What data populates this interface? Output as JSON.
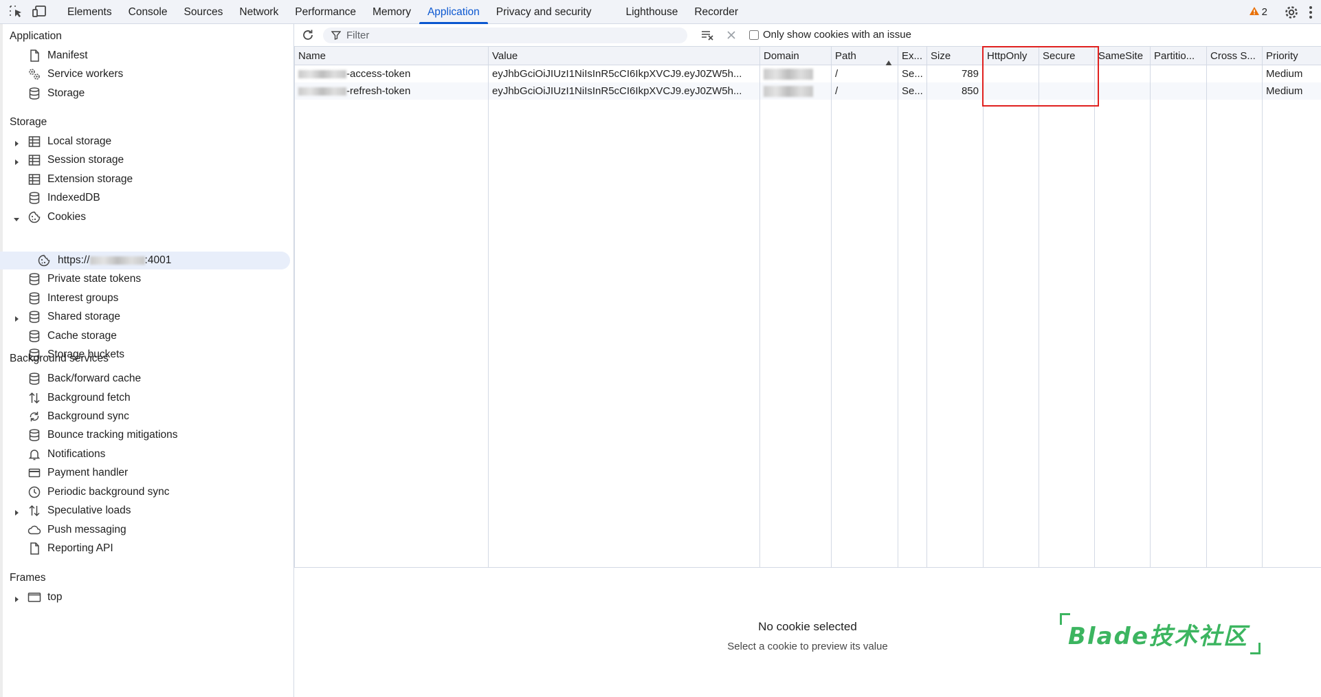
{
  "tabs": [
    {
      "label": "Elements"
    },
    {
      "label": "Console"
    },
    {
      "label": "Sources"
    },
    {
      "label": "Network"
    },
    {
      "label": "Performance"
    },
    {
      "label": "Memory"
    },
    {
      "label": "Application",
      "active": true
    },
    {
      "label": "Privacy and security"
    },
    {
      "label": "Lighthouse"
    },
    {
      "label": "Recorder"
    }
  ],
  "warnings": {
    "count": "2"
  },
  "colors": {
    "accent": "#0b57d0",
    "highlight": "#e0201e",
    "warning": "#e8710a",
    "watermark": "#3cb560"
  },
  "sidebar": {
    "application": {
      "title": "Application",
      "items": [
        {
          "label": "Manifest",
          "icon": "file-icon"
        },
        {
          "label": "Service workers",
          "icon": "gears-icon"
        },
        {
          "label": "Storage",
          "icon": "database-icon"
        }
      ]
    },
    "storage": {
      "title": "Storage",
      "items": [
        {
          "label": "Local storage",
          "icon": "table-icon"
        },
        {
          "label": "Session storage",
          "icon": "table-icon"
        },
        {
          "label": "Extension storage",
          "icon": "table-icon"
        },
        {
          "label": "IndexedDB",
          "icon": "database-icon"
        },
        {
          "label": "Cookies",
          "icon": "cookie-icon"
        },
        {
          "label": "https://",
          "suffix": ":4001",
          "icon": "cookie-icon"
        },
        {
          "label": "Private state tokens",
          "icon": "database-icon"
        },
        {
          "label": "Interest groups",
          "icon": "database-icon"
        },
        {
          "label": "Shared storage",
          "icon": "database-icon"
        },
        {
          "label": "Cache storage",
          "icon": "database-icon"
        },
        {
          "label": "Storage buckets",
          "icon": "database-icon"
        }
      ]
    },
    "background": {
      "title": "Background services",
      "items": [
        {
          "label": "Back/forward cache",
          "icon": "database-icon"
        },
        {
          "label": "Background fetch",
          "icon": "up-down-arrows-icon"
        },
        {
          "label": "Background sync",
          "icon": "sync-icon"
        },
        {
          "label": "Bounce tracking mitigations",
          "icon": "database-icon"
        },
        {
          "label": "Notifications",
          "icon": "bell-icon"
        },
        {
          "label": "Payment handler",
          "icon": "card-icon"
        },
        {
          "label": "Periodic background sync",
          "icon": "clock-icon"
        },
        {
          "label": "Speculative loads",
          "icon": "up-down-arrows-icon"
        },
        {
          "label": "Push messaging",
          "icon": "cloud-icon"
        },
        {
          "label": "Reporting API",
          "icon": "file-icon"
        }
      ]
    },
    "frames": {
      "title": "Frames",
      "items": [
        {
          "label": "top",
          "icon": "frame-icon"
        }
      ]
    }
  },
  "toolbar": {
    "filter_placeholder": "Filter",
    "only_issues_label": "Only show cookies with an issue"
  },
  "cookies_table": {
    "columns": [
      "Name",
      "Value",
      "Domain",
      "Path",
      "Ex...",
      "Size",
      "HttpOnly",
      "Secure",
      "SameSite",
      "Partitio...",
      "Cross S...",
      "Priority"
    ],
    "rows": [
      {
        "name": "-access-token",
        "value": "eyJhbGciOiJIUzI1NiIsInR5cCI6IkpXVCJ9.eyJ0ZW5h...",
        "domain": "",
        "path": "/",
        "expires": "Se...",
        "size": "789",
        "httponly": "",
        "secure": "",
        "samesite": "",
        "partition": "",
        "cross_site": "",
        "priority": "Medium"
      },
      {
        "name": "-refresh-token",
        "value": "eyJhbGciOiJIUzI1NiIsInR5cCI6IkpXVCJ9.eyJ0ZW5h...",
        "domain": "",
        "path": "/",
        "expires": "Se...",
        "size": "850",
        "httponly": "",
        "secure": "",
        "samesite": "",
        "partition": "",
        "cross_site": "",
        "priority": "Medium"
      }
    ]
  },
  "preview": {
    "title": "No cookie selected",
    "subtitle": "Select a cookie to preview its value"
  },
  "watermark": {
    "text": "Blade技术社区"
  }
}
